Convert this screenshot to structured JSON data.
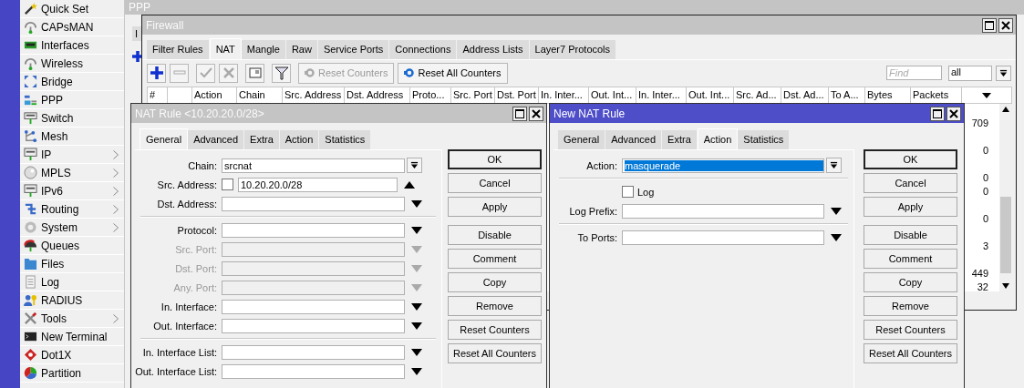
{
  "menu": [
    {
      "label": "Quick Set",
      "submenu": false
    },
    {
      "label": "CAPsMAN",
      "submenu": false
    },
    {
      "label": "Interfaces",
      "submenu": false
    },
    {
      "label": "Wireless",
      "submenu": false
    },
    {
      "label": "Bridge",
      "submenu": false
    },
    {
      "label": "PPP",
      "submenu": false
    },
    {
      "label": "Switch",
      "submenu": false
    },
    {
      "label": "Mesh",
      "submenu": false
    },
    {
      "label": "IP",
      "submenu": true
    },
    {
      "label": "MPLS",
      "submenu": true
    },
    {
      "label": "IPv6",
      "submenu": true
    },
    {
      "label": "Routing",
      "submenu": true
    },
    {
      "label": "System",
      "submenu": true
    },
    {
      "label": "Queues",
      "submenu": false
    },
    {
      "label": "Files",
      "submenu": false
    },
    {
      "label": "Log",
      "submenu": false
    },
    {
      "label": "RADIUS",
      "submenu": false
    },
    {
      "label": "Tools",
      "submenu": true
    },
    {
      "label": "New Terminal",
      "submenu": false
    },
    {
      "label": "Dot1X",
      "submenu": false
    },
    {
      "label": "Partition",
      "submenu": false
    }
  ],
  "ppp_window": {
    "title": "PPP",
    "tab": "I"
  },
  "firewall": {
    "title": "Firewall",
    "tabs": [
      {
        "label": "Filter Rules",
        "selected": false
      },
      {
        "label": "NAT",
        "selected": true
      },
      {
        "label": "Mangle",
        "selected": false
      },
      {
        "label": "Raw",
        "selected": false
      },
      {
        "label": "Service Ports",
        "selected": false
      },
      {
        "label": "Connections",
        "selected": false
      },
      {
        "label": "Address Lists",
        "selected": false
      },
      {
        "label": "Layer7 Protocols",
        "selected": false
      }
    ],
    "tools": [
      {
        "kind": "add",
        "disabled": false
      },
      {
        "kind": "remove",
        "disabled": true
      },
      {
        "kind": "enable",
        "disabled": true
      },
      {
        "kind": "disable",
        "disabled": true
      },
      {
        "kind": "comment",
        "disabled": false
      },
      {
        "kind": "filter",
        "disabled": false
      }
    ],
    "counter_buttons": [
      {
        "label": "Reset Counters",
        "disabled": true
      },
      {
        "label": "Reset All Counters",
        "disabled": false
      }
    ],
    "find": {
      "placeholder": "Find"
    },
    "filter_value": "all",
    "columns": [
      "#",
      "Action",
      "Chain",
      "Src. Address",
      "Dst. Address",
      "Proto...",
      "Src. Port",
      "Dst. Port",
      "In. Inter...",
      "Out. Int...",
      "In. Inter...",
      "Out. Int...",
      "Src. Ad...",
      "Dst. Ad...",
      "To A...",
      "Bytes",
      "Packets"
    ],
    "packets": [
      "709",
      "0",
      "0",
      "0",
      "0",
      "3",
      "449",
      "32"
    ]
  },
  "nat_rule": {
    "title": "NAT Rule <10.20.20.0/28>",
    "active": false,
    "tabs": [
      {
        "label": "General",
        "selected": true
      },
      {
        "label": "Advanced",
        "selected": false
      },
      {
        "label": "Extra",
        "selected": false
      },
      {
        "label": "Action",
        "selected": false
      },
      {
        "label": "Statistics",
        "selected": false
      }
    ],
    "fields": [
      {
        "kind": "select",
        "label": "Chain:",
        "value": "srcnat",
        "value_selected": false
      },
      {
        "kind": "negatable",
        "label": "Src. Address:",
        "value": "10.20.20.0/28",
        "checked": false,
        "expanded": true
      },
      {
        "kind": "combo",
        "label": "Dst. Address:",
        "disabled": false,
        "expanded": false
      },
      {
        "kind": "separator"
      },
      {
        "kind": "combo",
        "label": "Protocol:",
        "disabled": false,
        "expanded": false
      },
      {
        "kind": "combo",
        "label": "Src. Port:",
        "disabled": true,
        "expanded": false
      },
      {
        "kind": "combo",
        "label": "Dst. Port:",
        "disabled": true,
        "expanded": false
      },
      {
        "kind": "combo",
        "label": "Any. Port:",
        "disabled": true,
        "expanded": false
      },
      {
        "kind": "combo",
        "label": "In. Interface:",
        "disabled": false,
        "expanded": false
      },
      {
        "kind": "combo",
        "label": "Out. Interface:",
        "disabled": false,
        "expanded": false
      },
      {
        "kind": "separator"
      },
      {
        "kind": "combo",
        "label": "In. Interface List:",
        "disabled": false,
        "expanded": false
      },
      {
        "kind": "combo",
        "label": "Out. Interface List:",
        "disabled": false,
        "expanded": false
      }
    ],
    "buttons": [
      "OK",
      "Cancel",
      "Apply",
      "Disable",
      "Comment",
      "Copy",
      "Remove",
      "Reset Counters",
      "Reset All Counters"
    ]
  },
  "new_nat_rule": {
    "title": "New NAT Rule",
    "active": true,
    "tabs": [
      {
        "label": "General",
        "selected": false
      },
      {
        "label": "Advanced",
        "selected": false
      },
      {
        "label": "Extra",
        "selected": false
      },
      {
        "label": "Action",
        "selected": true
      },
      {
        "label": "Statistics",
        "selected": false
      }
    ],
    "fields": [
      {
        "kind": "select",
        "label": "Action:",
        "value": "masquerade",
        "value_selected": true
      },
      {
        "kind": "separator"
      },
      {
        "kind": "checkbox",
        "label": "Log",
        "checked": false
      },
      {
        "kind": "combo",
        "label": "Log Prefix:",
        "disabled": false,
        "expanded": false
      },
      {
        "kind": "separator"
      },
      {
        "kind": "combo",
        "label": "To Ports:",
        "disabled": false,
        "expanded": false
      }
    ],
    "buttons": [
      "OK",
      "Cancel",
      "Apply",
      "Disable",
      "Comment",
      "Copy",
      "Remove",
      "Reset Counters",
      "Reset All Counters"
    ]
  }
}
